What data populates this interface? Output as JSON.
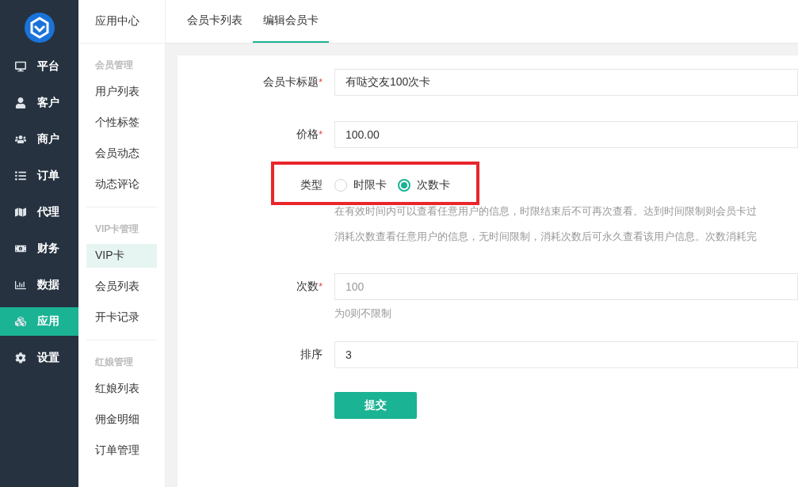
{
  "nav": [
    {
      "label": "平台",
      "selected": false
    },
    {
      "label": "客户",
      "selected": false
    },
    {
      "label": "商户",
      "selected": false
    },
    {
      "label": "订单",
      "selected": false
    },
    {
      "label": "代理",
      "selected": false
    },
    {
      "label": "财务",
      "selected": false
    },
    {
      "label": "数据",
      "selected": false
    },
    {
      "label": "应用",
      "selected": true
    },
    {
      "label": "设置",
      "selected": false
    }
  ],
  "subnav": {
    "title": "应用中心",
    "groups": [
      {
        "title": "会员管理",
        "items": [
          {
            "label": "用户列表",
            "selected": false
          },
          {
            "label": "个性标签",
            "selected": false
          },
          {
            "label": "会员动态",
            "selected": false
          },
          {
            "label": "动态评论",
            "selected": false
          }
        ]
      },
      {
        "title": "VIP卡管理",
        "items": [
          {
            "label": "VIP卡",
            "selected": true
          },
          {
            "label": "会员列表",
            "selected": false
          },
          {
            "label": "开卡记录",
            "selected": false
          }
        ]
      },
      {
        "title": "红娘管理",
        "items": [
          {
            "label": "红娘列表",
            "selected": false
          },
          {
            "label": "佣金明细",
            "selected": false
          },
          {
            "label": "订单管理",
            "selected": false
          }
        ]
      }
    ]
  },
  "tabs": [
    {
      "label": "会员卡列表",
      "selected": false
    },
    {
      "label": "编辑会员卡",
      "selected": true
    }
  ],
  "form": {
    "fields": [
      {
        "kind": "text",
        "label": "会员卡标题",
        "asterisk": "*",
        "value": "有哒交友100次卡"
      },
      {
        "kind": "text",
        "label": "价格",
        "asterisk": "*",
        "value": "100.00"
      },
      {
        "kind": "radio",
        "label": "类型",
        "highlighted": true,
        "options": [
          {
            "label": "时限卡",
            "selected": false
          },
          {
            "label": "次数卡",
            "selected": true
          }
        ],
        "notes": [
          "在有效时间内可以查看任意用户的信息，时限结束后不可再次查看。达到时间限制则会员卡过",
          "消耗次数查看任意用户的信息，无时间限制，消耗次数后可永久查看该用户信息。次数消耗完"
        ]
      },
      {
        "kind": "text",
        "label": "次数",
        "asterisk": "*",
        "placeholder": "100",
        "help": "为0则不限制"
      },
      {
        "kind": "text",
        "label": "排序",
        "value": "3"
      }
    ],
    "submit": "提交"
  }
}
